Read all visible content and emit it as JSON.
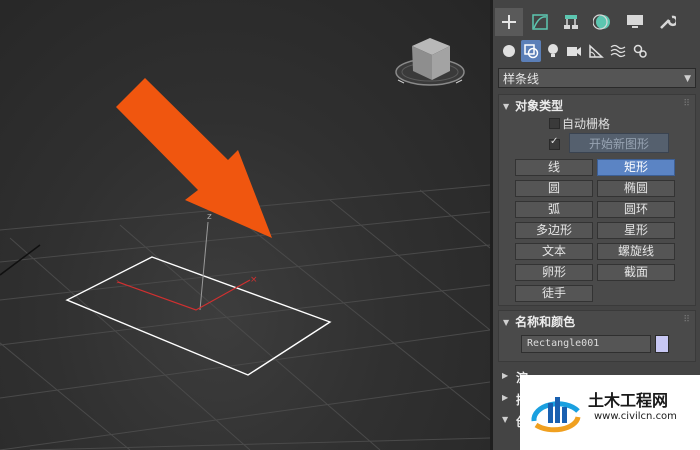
{
  "viewport": {
    "axis_label": "z",
    "colors": {
      "grid": "#4a4a4a",
      "arrow": "#f0560f",
      "rectangle": "#ffffff",
      "gizmo_x": "#d03030"
    }
  },
  "panel": {
    "top_icons": [
      "plus-icon",
      "curve-edit-icon",
      "hierarchy-icon",
      "motion-icon",
      "display-icon",
      "wrench-icon"
    ],
    "sub_icons": [
      "geometry-sphere-icon",
      "shapes-icon",
      "light-bulb-icon",
      "camera-icon",
      "helper-icon",
      "space-warp-icon",
      "systems-icon"
    ],
    "category_dropdown": "样条线",
    "object_type": {
      "header": "对象类型",
      "auto_grid": "自动栅格",
      "start_new_shape": "开始新图形",
      "buttons": [
        "线",
        "矩形",
        "圆",
        "椭圆",
        "弧",
        "圆环",
        "多边形",
        "星形",
        "文本",
        "螺旋线",
        "卵形",
        "截面",
        "徒手"
      ],
      "active": "矩形"
    },
    "name_color": {
      "header": "名称和颜色",
      "name": "Rectangle001",
      "color": "#c8c8f4"
    },
    "collapsed_rollouts": [
      "渲",
      "插",
      "创"
    ]
  },
  "watermark": {
    "title": "土木工程网",
    "url": "www.civilcn.com"
  }
}
